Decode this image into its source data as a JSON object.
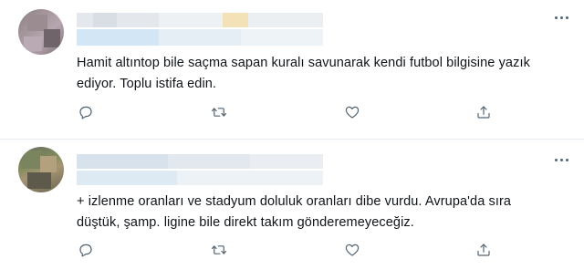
{
  "tweets": [
    {
      "text": "Hamit altıntop bile saçma sapan kuralı savunarak kendi futbol bilgisine yazık ediyor. Toplu istifa edin.",
      "actions": {
        "reply": "reply-icon",
        "retweet": "retweet-icon",
        "like": "heart-icon",
        "share": "share-icon"
      }
    },
    {
      "text": "+ izlenme oranları ve stadyum doluluk oranları dibe vurdu. Avrupa'da sıra düştük, şamp. ligine bile direkt takım gönderemeyeceğiz.",
      "actions": {
        "reply": "reply-icon",
        "retweet": "retweet-icon",
        "like": "heart-icon",
        "share": "share-icon"
      }
    }
  ],
  "colors": {
    "icon": "#536471",
    "text": "#0f1419",
    "divider": "#e6ecf0",
    "background": "#ffffff"
  }
}
